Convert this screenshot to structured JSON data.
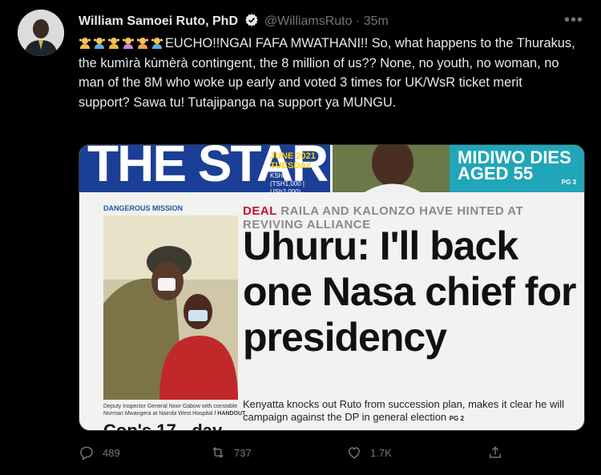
{
  "tweet": {
    "author_name": "William Samoei Ruto, PhD",
    "handle": "@WilliamsRuto",
    "separator": "·",
    "time": "35m",
    "text": "EUCHO!!NGAI FAFA MWATHANI!! So, what happens to the Thurakus, the kumìrà kùmèrà contingent, the 8 million of us?? None, no youth, no woman, no man of the 8M who woke up early and voted 3 times for UK/WsR ticket merit support? Sawa tu! Tutajipanga na support ya MUNGU.",
    "emoji_count": 6,
    "more_label": "•••"
  },
  "media": {
    "masthead": "THE STAR",
    "date_label": "JUNE 2021",
    "day_label": "TUESDAY",
    "price": "KSh60",
    "price_other": "(TSH1,000 | USh2,000)",
    "teal_headline": "MIDIWO DIES AGED 55",
    "teal_pg": "PG 3",
    "side_label": "DANGEROUS MISSION",
    "caption": "Deputy Inspector General Noor Gabow with constable Norman Mwangera at Nairobi West Hospital",
    "caption_credit": "/ HANDOUT",
    "bottom_head": "Cop's 17 - day",
    "deal_tag": "DEAL",
    "deal_rest": "RAILA AND KALONZO HAVE HINTED AT REVIVING ALLIANCE",
    "headline": "Uhuru: I'll back one Nasa chief for presidency",
    "subhead": "Kenyatta knocks out Ruto from succession plan, makes it clear he will campaign against the DP in general election",
    "subhead_pg": "PG 2"
  },
  "actions": {
    "reply_count": "489",
    "retweet_count": "737",
    "like_count": "1.7K",
    "share_count": ""
  },
  "icons": [
    "reply-icon",
    "retweet-icon",
    "like-icon",
    "share-icon",
    "verified-icon",
    "more-icon"
  ],
  "colors": {
    "background": "#000000",
    "text": "#e7e9ea",
    "muted": "#71767b",
    "verified": "#e7e9ea"
  }
}
